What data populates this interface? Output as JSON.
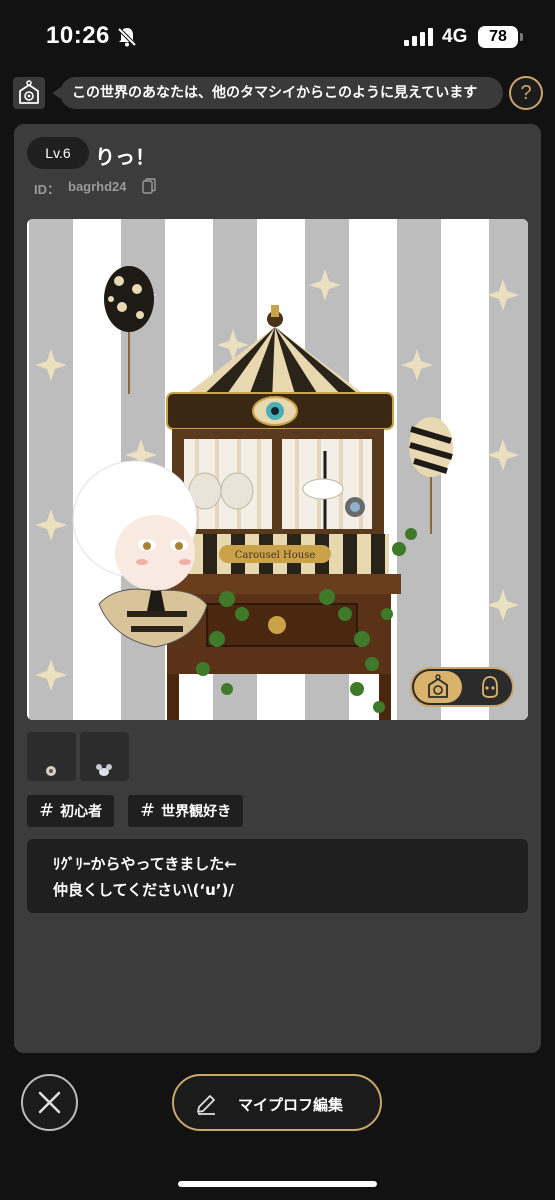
{
  "status_bar": {
    "time": "10:26",
    "network": "4G",
    "battery": "78",
    "icons": [
      "bell-slash-icon",
      "signal-icon",
      "battery-icon"
    ]
  },
  "notice": {
    "text": "この世界のあなたは、他のタマシイからこのように見えています",
    "help_label": "?"
  },
  "profile": {
    "level": "Lv.6",
    "name": "りっ！",
    "id_label": "ID：",
    "id_value": "bagrhd24",
    "avatar_scene": {
      "sign_text": "Carousel House",
      "toggle_icons": [
        "avatar-room-icon",
        "avatar-face-icon"
      ]
    },
    "tags": [
      "初心者",
      "世界観好き"
    ],
    "tag_symbol": "#",
    "bio_lines": [
      "ﾘｸﾞﾘｰからやってきました←",
      "仲良くしてください\\(‘u’)/"
    ]
  },
  "actions": {
    "edit_label": "マイプロフ編集"
  },
  "colors": {
    "background": "#121212",
    "card": "#3c3c3c",
    "dark_chip": "#1f1f1f",
    "accent_gold": "#c9a66b"
  }
}
